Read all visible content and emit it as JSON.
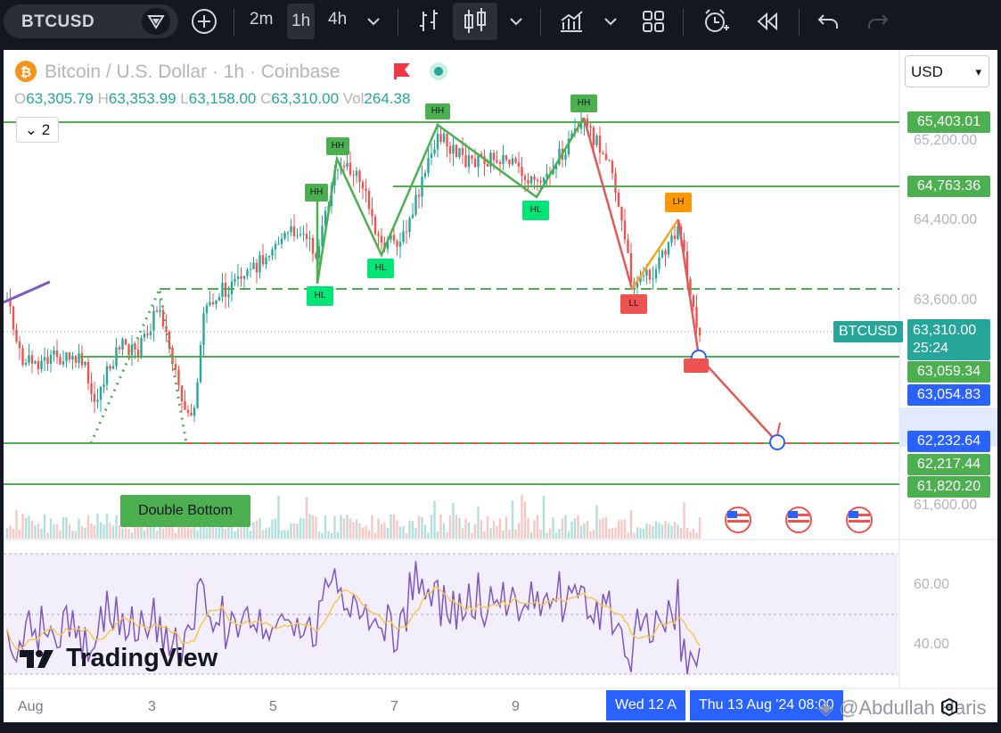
{
  "toolbar": {
    "symbol": "BTCUSD",
    "intervals": [
      {
        "label": "2m",
        "active": false
      },
      {
        "label": "1h",
        "active": true
      },
      {
        "label": "4h",
        "active": false
      }
    ],
    "icons": [
      "search-icon",
      "add-compare-icon",
      "interval-dropdown-icon",
      "bar-chart-icon",
      "candle-chart-icon",
      "chart-type-dropdown-icon",
      "indicators-icon",
      "indicators-dropdown-icon",
      "layout-icon",
      "alert-icon",
      "replay-icon",
      "undo-icon",
      "redo-icon"
    ]
  },
  "legend": {
    "title": "Bitcoin / U.S. Dollar · 1h · Coinbase",
    "open_label": "O",
    "open": "63,305.79",
    "high_label": "H",
    "high": "63,353.99",
    "low_label": "L",
    "low": "63,158.00",
    "close_label": "C",
    "close": "63,310.00",
    "vol_label": "Vol",
    "vol": "264.38",
    "collapse_count": "2"
  },
  "currency": {
    "selected": "USD"
  },
  "price_axis": {
    "ticks": [
      "65,200.00",
      "64,400.00",
      "63,600.00",
      "61,600.00"
    ],
    "levels": [
      {
        "value": "65,403.01",
        "color": "#4caf50"
      },
      {
        "value": "64,763.36",
        "color": "#4caf50"
      },
      {
        "value": "63,059.34",
        "color": "#4caf50"
      },
      {
        "value": "63,054.83",
        "color": "#2962ff"
      },
      {
        "value": "62,232.64",
        "color": "#2962ff"
      },
      {
        "value": "62,217.44",
        "color": "#4caf50"
      },
      {
        "value": "61,820.20",
        "color": "#4caf50"
      }
    ],
    "current_symbol": "BTCUSD",
    "current_price": "63,310.00",
    "countdown": "25:24"
  },
  "annotations": {
    "markers": [
      "HH",
      "HH",
      "HH",
      "HH",
      "HL",
      "HL",
      "HL",
      "LH",
      "LL"
    ],
    "double_bottom": "Double Bottom"
  },
  "rsi": {
    "ticks": [
      "60.00",
      "40.00"
    ]
  },
  "time_axis": {
    "labels": [
      "Aug",
      "3",
      "5",
      "7",
      "9"
    ],
    "tag_left": "Wed 12 A",
    "tag_right": "Thu 13 Aug '24 08:00"
  },
  "brand": "TradingView",
  "watermark": "@Abdullah Haris",
  "colors": {
    "up": "#26a69a",
    "down": "#ef5350",
    "level": "#4caf50",
    "accent": "#2962ff",
    "rsi": "#7e57c2",
    "rsi_ma": "#f9c74f"
  },
  "chart_data": {
    "type": "candlestick",
    "symbol": "BTCUSD",
    "interval": "1h",
    "ohlc_last": {
      "open": 63305.79,
      "high": 63353.99,
      "low": 63158.0,
      "close": 63310.0,
      "volume": 264.38
    },
    "ylim": [
      61500,
      65600
    ],
    "levels": [
      65403.01,
      64763.36,
      63059.34,
      63054.83,
      62232.64,
      62217.44,
      61820.2
    ],
    "x_ticks": [
      "Aug",
      "3",
      "5",
      "7",
      "9"
    ],
    "rsi_levels": [
      60,
      40
    ]
  }
}
